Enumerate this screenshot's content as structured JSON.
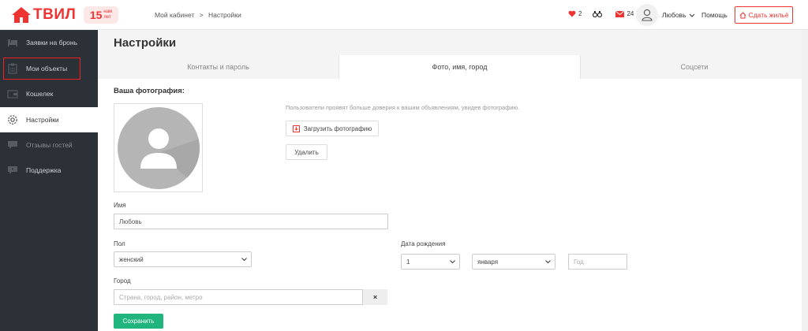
{
  "brand": {
    "logo_text": "ТВИЛ",
    "badge_number": "15",
    "badge_word1": "нам",
    "badge_word2": "лет",
    "accent": "#e33333"
  },
  "header": {
    "breadcrumb": [
      "Мой кабинет",
      ">",
      "Настройки"
    ],
    "favorites_count": "2",
    "messages_count": "24",
    "user_name": "Любовь",
    "help_label": "Помощь",
    "rent_button": "Сдать жильё"
  },
  "sidebar": {
    "items": [
      {
        "label": "Заявки на бронь",
        "icon": "bed-icon"
      },
      {
        "label": "Мои объекты",
        "icon": "clipboard-icon"
      },
      {
        "label": "Кошелек",
        "icon": "wallet-icon"
      },
      {
        "label": "Настройки",
        "icon": "gear-icon"
      },
      {
        "label": "Отзывы гостей",
        "icon": "chat-icon"
      },
      {
        "label": "Поддержка",
        "icon": "support-icon"
      }
    ]
  },
  "main": {
    "title": "Настройки",
    "tabs": [
      {
        "label": "Контакты и пароль"
      },
      {
        "label": "Фото, имя, город"
      },
      {
        "label": "Соцсети"
      }
    ],
    "photo_section_label": "Ваша фотография:",
    "photo_hint": "Пользователи проявят больше доверия к вашим объявлениям, увидев фотографию.",
    "upload_button": "Загрузить фотографию",
    "delete_button": "Удалить",
    "name_label": "Имя",
    "name_value": "Любовь",
    "gender_label": "Пол",
    "gender_value": "женский",
    "birth_label": "Дата рождения",
    "birth_day": "1",
    "birth_month": "января",
    "birth_year_placeholder": "Год",
    "city_label": "Город",
    "city_placeholder": "Страна, город, район, метро",
    "clear_symbol": "×",
    "save_button": "Сохранить",
    "save_color": "#1fb57c"
  }
}
